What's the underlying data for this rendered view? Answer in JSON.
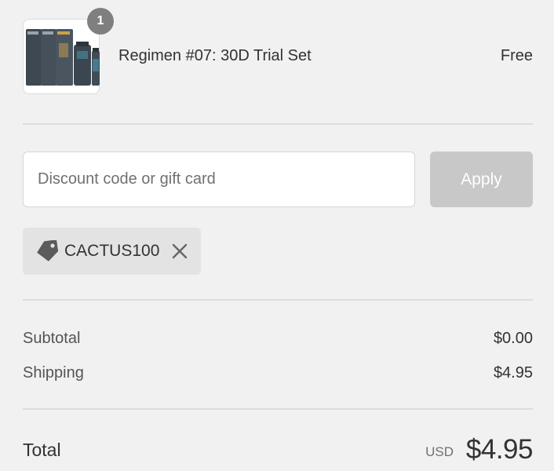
{
  "product": {
    "quantity": "1",
    "name": "Regimen #07: 30D Trial Set",
    "price": "Free"
  },
  "discount": {
    "placeholder": "Discount code or gift card",
    "value": "",
    "apply_label": "Apply",
    "applied_code": "CACTUS100"
  },
  "totals": {
    "subtotal_label": "Subtotal",
    "subtotal_value": "$0.00",
    "shipping_label": "Shipping",
    "shipping_value": "$4.95",
    "total_label": "Total",
    "currency": "USD",
    "total_value": "$4.95"
  },
  "colors": {
    "background": "#f1f1f1",
    "apply_disabled": "#c8c8c8",
    "chip": "#e3e3e3",
    "badge": "#7f7f7f"
  },
  "icons": {
    "product_image": "product-thumbnail",
    "tag": "tag-icon",
    "remove": "close-icon"
  }
}
